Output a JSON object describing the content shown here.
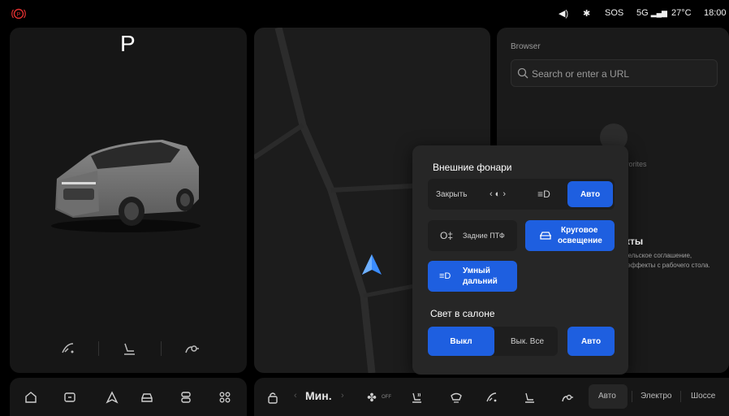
{
  "status": {
    "volume_icon": "volume-icon",
    "bluetooth_icon": "bluetooth-icon",
    "sos": "SOS",
    "network": "5G",
    "temperature": "27°C",
    "time": "18:00"
  },
  "vehicle": {
    "gear": "P"
  },
  "browser": {
    "label": "Browser",
    "search_placeholder": "Search or enter a URL",
    "favorites_text": "vorites",
    "effects_title": "кты",
    "effects_line1": "тельское соглашение,",
    "effects_line2": "-эффекты с рабочего стола."
  },
  "lights_popup": {
    "exterior_title": "Внешние фонари",
    "exterior_options": {
      "close": "Закрыть",
      "auto": "Авто"
    },
    "rear_fog": "Задние ПТФ",
    "ambient_line1": "Круговое",
    "ambient_line2": "освещение",
    "smart_line1": "Умный",
    "smart_line2": "дальний",
    "cabin_title": "Свет в салоне",
    "cabin_options": {
      "off": "Выкл",
      "all_off": "Вык. Все",
      "auto": "Авто"
    }
  },
  "dock": {
    "fan_label": "Мин.",
    "fan_off": "OFF",
    "mode_auto": "Авто",
    "mode_electric": "Электро",
    "mode_highway": "Шоссе"
  },
  "colors": {
    "accent": "#1e5fe0",
    "warning": "#e03030",
    "nav_arrow": "#3a8cff"
  }
}
